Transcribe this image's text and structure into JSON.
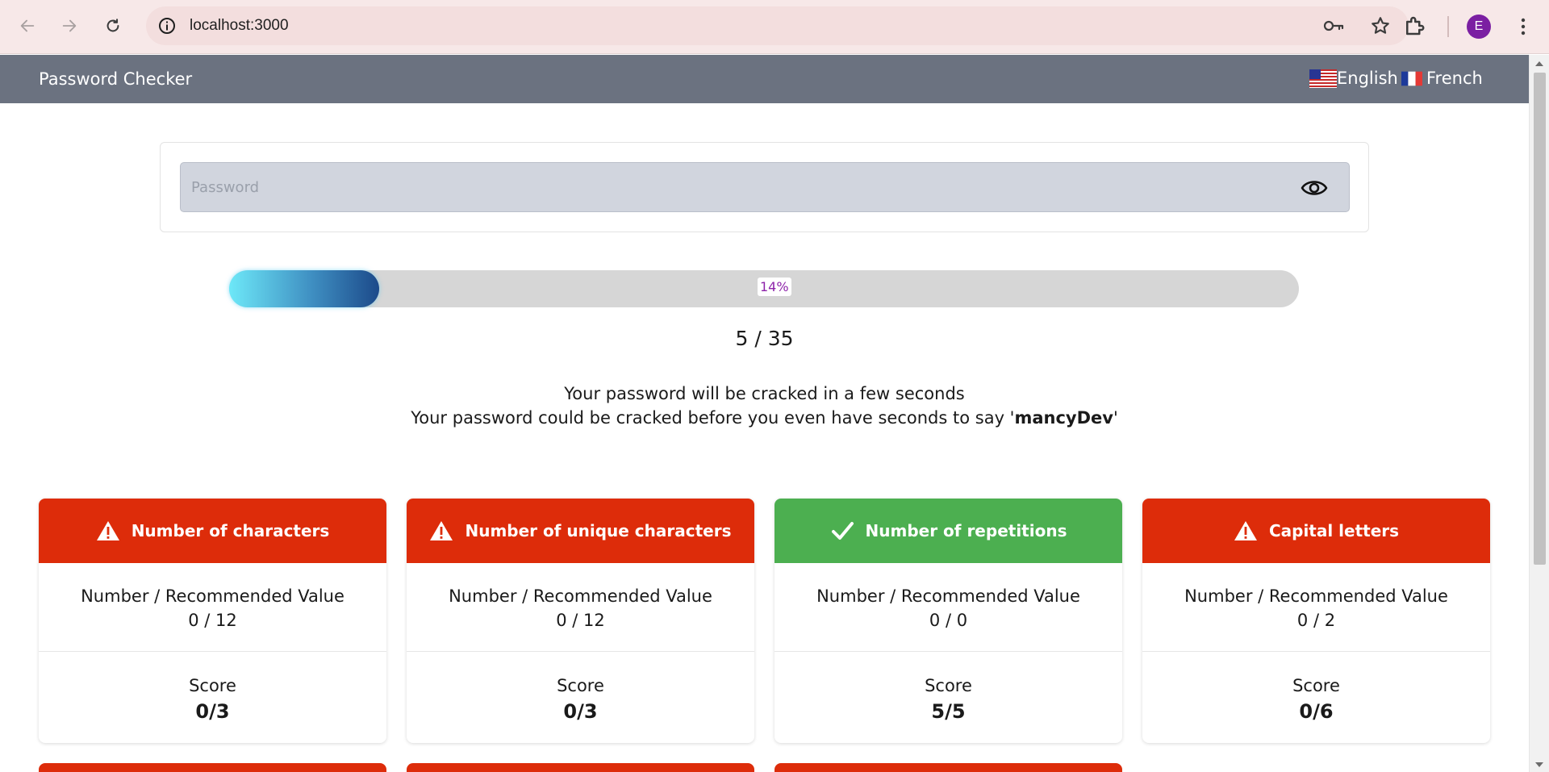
{
  "browser": {
    "url": "localhost:3000",
    "avatar_letter": "E"
  },
  "app": {
    "title": "Password Checker",
    "languages": [
      {
        "label": "English",
        "flag": "us-flag-icon"
      },
      {
        "label": "French",
        "flag": "fr-flag-icon"
      }
    ]
  },
  "password": {
    "placeholder": "Password",
    "value": ""
  },
  "progress": {
    "percent": 14,
    "label": "14%"
  },
  "score_total": "5 / 35",
  "crack_messages": {
    "line1": "Your password will be cracked in a few seconds",
    "line2_prefix": "Your password could be cracked before you even have seconds to say '",
    "line2_word": "mancyDev",
    "line2_suffix": "'"
  },
  "criteria": [
    {
      "title": "Number of characters",
      "status": "bad",
      "icon": "warning-icon",
      "metric_label": "Number / Recommended Value",
      "metric_value": "0 / 12",
      "score_label": "Score",
      "score": "0/3"
    },
    {
      "title": "Number of unique characters",
      "status": "bad",
      "icon": "warning-icon",
      "metric_label": "Number / Recommended Value",
      "metric_value": "0 / 12",
      "score_label": "Score",
      "score": "0/3"
    },
    {
      "title": "Number of repetitions",
      "status": "good",
      "icon": "checkmark-icon",
      "metric_label": "Number / Recommended Value",
      "metric_value": "0 / 0",
      "score_label": "Score",
      "score": "5/5"
    },
    {
      "title": "Capital letters",
      "status": "bad",
      "icon": "warning-icon",
      "metric_label": "Number / Recommended Value",
      "metric_value": "0 / 2",
      "score_label": "Score",
      "score": "0/6"
    }
  ],
  "colors": {
    "header_bg": "#6b7280",
    "bad": "#dd2c0a",
    "good": "#4caf50",
    "progress_label": "#8e24aa"
  }
}
